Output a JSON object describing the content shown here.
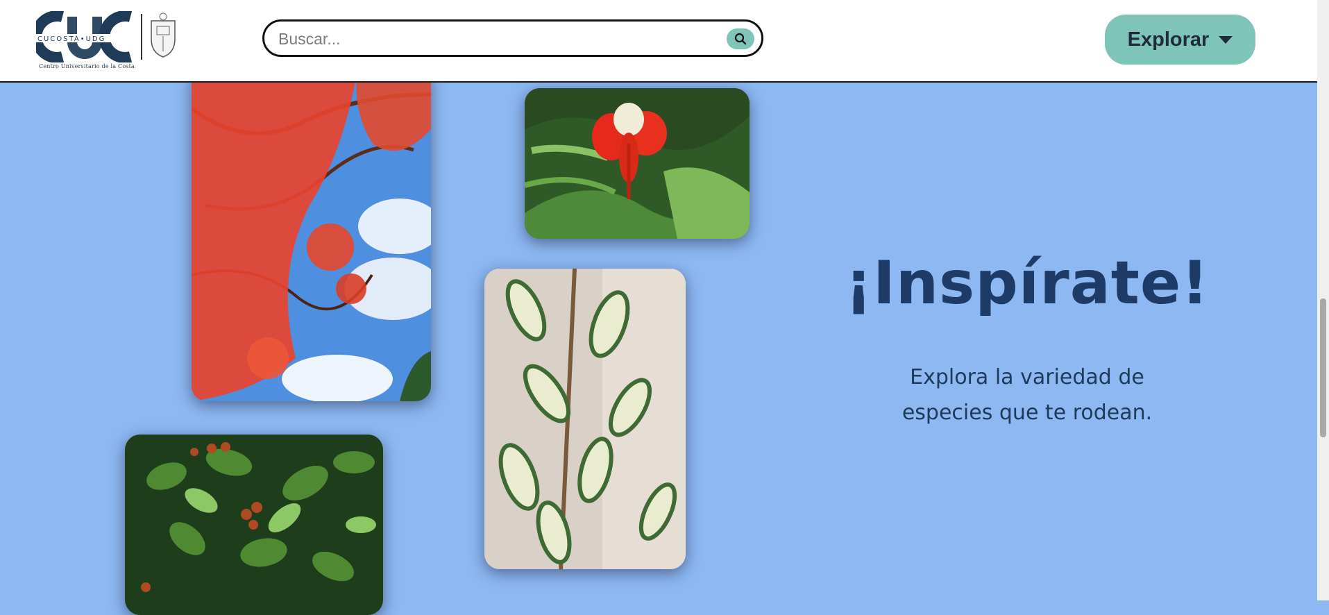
{
  "header": {
    "logo": {
      "mark": "CUC",
      "line": "CUCOSTA•UDG",
      "caption": "Centro Universitario de la Costa"
    },
    "search": {
      "placeholder": "Buscar...",
      "icon": "search-icon"
    },
    "explore": {
      "label": "Explorar",
      "icon": "caret-down-icon"
    }
  },
  "hero": {
    "title": "¡Inspírate!",
    "subtitle_line1": "Explora la variedad de",
    "subtitle_line2": "especies que te rodean."
  },
  "photos": [
    {
      "name": "flamboyan-tree-photo",
      "subject": "red flowering tree against blue sky"
    },
    {
      "name": "red-flower-photo",
      "subject": "red flamboyan flower among fern-like leaves"
    },
    {
      "name": "variegated-ficus-photo",
      "subject": "variegated ficus leaves"
    },
    {
      "name": "ficus-berries-photo",
      "subject": "green ficus leaves with red berries"
    }
  ],
  "colors": {
    "background": "#8db8f2",
    "accent": "#7fc4b8",
    "headline": "#1e3a66"
  }
}
